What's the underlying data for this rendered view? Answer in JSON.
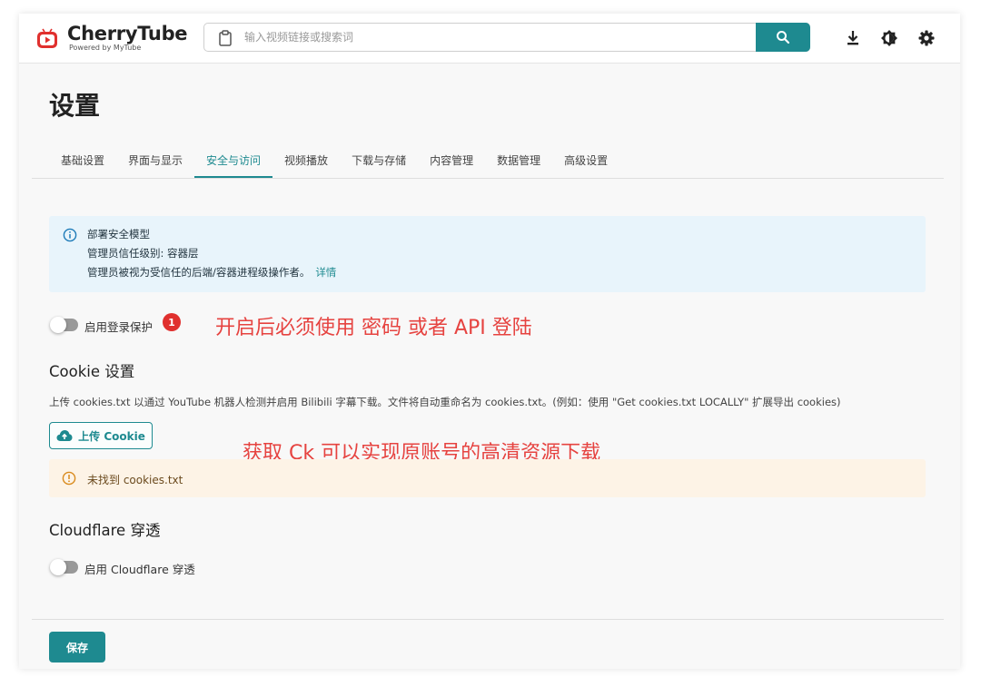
{
  "app": {
    "name": "CherryTube",
    "subtitle": "Powered by MyTube"
  },
  "search": {
    "placeholder": "输入视频链接或搜索词"
  },
  "page": {
    "title": "设置"
  },
  "tabs": [
    {
      "label": "基础设置"
    },
    {
      "label": "界面与显示"
    },
    {
      "label": "安全与访问",
      "active": true
    },
    {
      "label": "视频播放"
    },
    {
      "label": "下载与存储"
    },
    {
      "label": "内容管理"
    },
    {
      "label": "数据管理"
    },
    {
      "label": "高级设置"
    }
  ],
  "security_info": {
    "title": "部署安全模型",
    "line2": "管理员信任级别: 容器层",
    "line3": "管理员被视为受信任的后端/容器进程级操作者。",
    "link": "详情"
  },
  "login_protection": {
    "label": "启用登录保护",
    "enabled": false,
    "badge": "1"
  },
  "annotations": {
    "login_note": "开启后必须使用 密码 或者 API 登陆",
    "cookie_note": "获取 Ck 可以实现原账号的高清资源下载"
  },
  "cookie": {
    "section_title": "Cookie 设置",
    "description": "上传 cookies.txt 以通过 YouTube 机器人检测并启用 Bilibili 字幕下载。文件将自动重命名为 cookies.txt。(例如：使用 \"Get cookies.txt LOCALLY\" 扩展导出 cookies)",
    "upload_label": "上传 Cookie",
    "warning": "未找到 cookies.txt"
  },
  "cloudflare": {
    "section_title": "Cloudflare 穿透",
    "toggle_label": "启用 Cloudflare 穿透",
    "enabled": false
  },
  "footer": {
    "save_label": "保存"
  },
  "colors": {
    "accent": "#1e8a90",
    "annotation": "#e64340",
    "badge": "#e0302e",
    "info_bg": "#e8f4fb",
    "warning_bg": "#fdf3e6"
  },
  "icons": {
    "logo": "youtube-play-icon",
    "search_prefix": "clipboard-icon",
    "search_button": "search-icon",
    "download": "download-icon",
    "theme": "theme-toggle-icon",
    "settings": "gear-icon",
    "info": "info-circle-icon",
    "upload": "cloud-upload-icon",
    "warning": "warning-circle-icon"
  }
}
